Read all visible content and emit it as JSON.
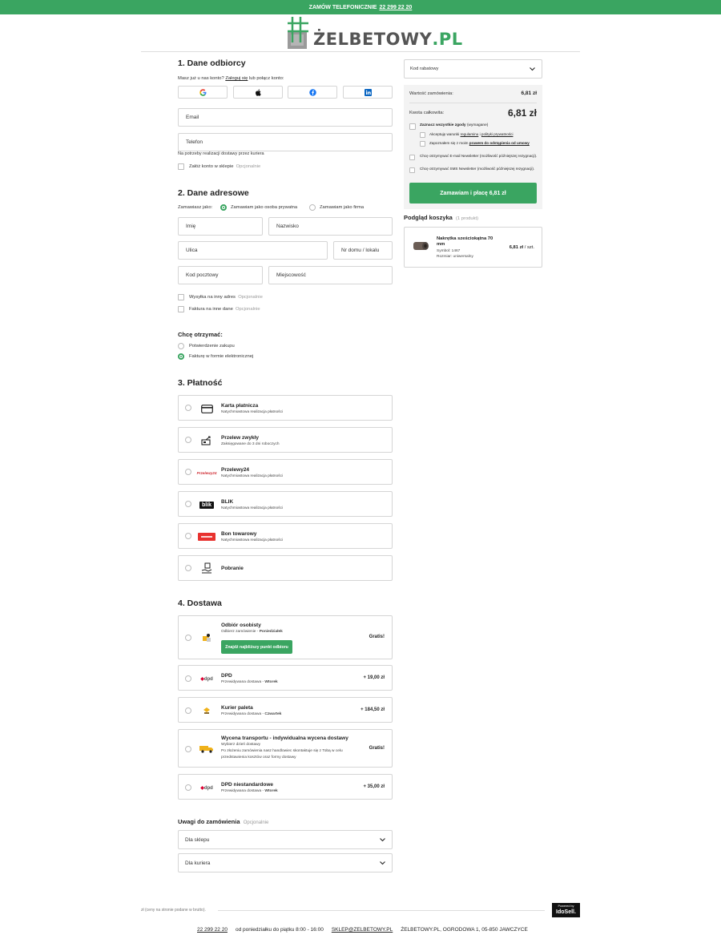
{
  "topbar": {
    "label": "ZAMÓW TELEFONICZNIE",
    "phone": "22 299 22 20"
  },
  "logo": {
    "prefix": "ŻELBETOWY",
    "suffix": ".PL"
  },
  "recipient": {
    "title": "1. Dane odbiorcy",
    "login_prompt": "Masz już u nas konto?",
    "login_link": "Zaloguj się",
    "login_suffix": "lub połącz konto:",
    "email_label": "Email",
    "phone_label": "Telefon",
    "phone_note": "Na potrzeby realizacji dostawy przez kuriera",
    "create_account": "Załóż konto w sklepie",
    "optional": "Opcjonalnie"
  },
  "address": {
    "title": "2. Dane adresowe",
    "order_as": "Zamawiasz jako:",
    "private": "Zamawiam jako osoba prywatna",
    "company": "Zamawiam jako firma",
    "first_name": "Imię",
    "last_name": "Nazwisko",
    "street": "Ulica",
    "house_no": "Nr domu / lokalu",
    "postal": "Kod pocztowy",
    "city": "Miejscowość",
    "other_address": "Wysyłka na inny adres",
    "other_invoice": "Faktura na inne dane",
    "optional": "Opcjonalnie",
    "receive_title": "Chcę otrzymać:",
    "receive_confirm": "Potwierdzenie zakupu",
    "receive_invoice": "Fakturę w formie elektronicznej"
  },
  "payment": {
    "title": "3. Płatność",
    "options": [
      {
        "name": "Karta płatnicza",
        "sub": "Natychmiastowa realizacja płatności",
        "icon": "card-icon"
      },
      {
        "name": "Przelew zwykły",
        "sub": "Zaksięgowane do 3 dni roboczych",
        "icon": "bank-transfer-icon"
      },
      {
        "name": "Przelewy24",
        "sub": "Natychmiastowa realizacja płatności",
        "icon": "przelewy24-icon",
        "logo_text": "Przelewy24"
      },
      {
        "name": "BLIK",
        "sub": "Natychmiastowa realizacja płatności",
        "icon": "blik-icon",
        "logo_text": "blik"
      },
      {
        "name": "Bon towarowy",
        "sub": "Natychmiastowa realizacja płatności",
        "icon": "voucher-icon"
      },
      {
        "name": "Pobranie",
        "sub": "",
        "icon": "cash-on-delivery-icon"
      }
    ]
  },
  "delivery": {
    "title": "4. Dostawa",
    "options": [
      {
        "name": "Odbiór osobisty",
        "sub": "Odbierz zamówienie",
        "day": "Poniedziałek",
        "price": "Gratis!",
        "icon": "pickup-icon",
        "button": "Znajdź najbliższy punkt odbioru"
      },
      {
        "name": "DPD",
        "sub": "Przewidywana dostawa",
        "day": "Wtorek",
        "price": "+ 19,00 zł",
        "icon": "dpd-icon",
        "logo_text": "dpd"
      },
      {
        "name": "Kurier paleta",
        "sub": "Przewidywana dostawa",
        "day": "Czwartek",
        "price": "+ 184,50 zł",
        "icon": "pallet-icon"
      },
      {
        "name": "Wycena transportu - indywidualna wycena dostawy",
        "sub": "Wybierz dzień dostawy",
        "note1": "Po złożeniu zamówienia nasz handlowiec skontaktuje się z Tobą w celu",
        "note2": "przedstawienia kosztów oraz formy dostawy",
        "price": "Gratis!",
        "icon": "truck-icon"
      },
      {
        "name": "DPD niestandardowe",
        "sub": "Przewidywana dostawa",
        "day": "Wtorek",
        "price": "+ 35,00 zł",
        "icon": "dpd-icon",
        "logo_text": "dpd"
      }
    ]
  },
  "notes": {
    "title": "Uwagi do zamówienia",
    "optional": "Opcjonalnie",
    "for_shop": "Dla sklepu",
    "for_courier": "Dla kuriera"
  },
  "summary": {
    "discount_label": "Kod rabatowy",
    "order_value_label": "Wartość zamówienia:",
    "order_value": "6,81 zł",
    "total_label": "Kwota całkowita:",
    "total": "6,81 zł",
    "consent_all": "Zaznacz wszystkie zgody",
    "consent_required": "(wymagane)",
    "terms_prefix": "Akceptuję warunki",
    "terms_link1": "regulaminu",
    "terms_mid": "i",
    "terms_link2": "polityki prywatności",
    "withdraw_prefix": "Zapoznałem się z moim",
    "withdraw_link": "prawem do odstąpienia od umowy",
    "newsletter_email": "Chcę otrzymywać E-mail Newsletter (możliwość późniejszej rezygnacji).",
    "newsletter_sms": "Chcę otrzymywać SMS Newsletter (możliwość późniejszej rezygnacji).",
    "order_button": "Zamawiam i płacę 6,81 zł"
  },
  "cart": {
    "title": "Podgląd koszyka",
    "count": "(1 produkt)",
    "product_name": "Nakrętka sześciokątna 70 mm",
    "symbol": "Symbol: 1467",
    "size": "Rozmiar: uniwersalny",
    "price": "6,81 zł",
    "unit": "/ szt."
  },
  "footer": {
    "prices_note": "zł (ceny na stronie podane w brutto).",
    "phone": "22 299 22 20",
    "hours": "od poniedziałku do piątku 8:00 - 16:00",
    "email": "SKLEP@ZELBETOWY.PL",
    "address": "ŻELBETOWY.PL, OGRODOWA 1, 05-850 JAWCZYCE",
    "powered_by": "Powered by",
    "idosell": "IdoSell."
  },
  "colors": {
    "brand": "#3aa561",
    "border": "#d5d5d5",
    "panel": "#f3f3f3"
  }
}
